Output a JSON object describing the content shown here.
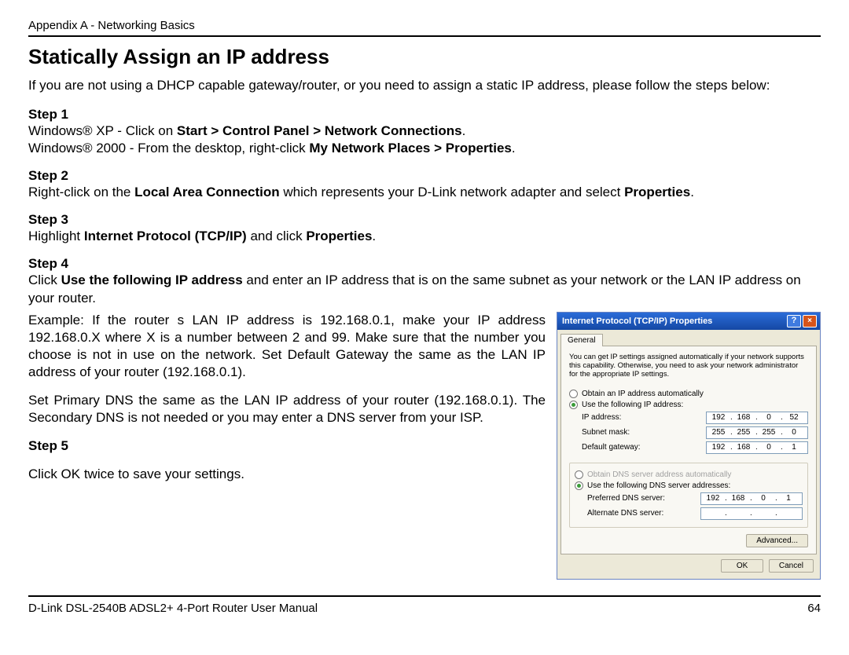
{
  "header": {
    "appendix": "Appendix A - Networking Basics"
  },
  "title": "Statically Assign an IP address",
  "intro": "If you are not using a DHCP capable gateway/router, or you need to assign a static IP address, please follow the steps below:",
  "steps": {
    "s1": {
      "label": "Step 1",
      "xp_prefix": "Windows® XP - Click on ",
      "xp_bold": "Start > Control Panel > Network Connections",
      "xp_suffix": ".",
      "w2k_prefix": "Windows® 2000 - From the desktop, right-click ",
      "w2k_bold": "My Network Places > Properties",
      "w2k_suffix": "."
    },
    "s2": {
      "label": "Step 2",
      "prefix": "Right-click on the ",
      "bold1": "Local Area Connection",
      "mid": " which represents your D-Link network adapter and select ",
      "bold2": "Properties",
      "suffix": "."
    },
    "s3": {
      "label": "Step 3",
      "prefix": "Highlight ",
      "bold1": "Internet Protocol (TCP/IP)",
      "mid": " and click ",
      "bold2": "Properties",
      "suffix": "."
    },
    "s4": {
      "label": "Step 4",
      "p1_prefix": "Click ",
      "p1_bold": "Use the following IP address",
      "p1_suffix": " and enter an IP address that is on the same subnet as your network or the LAN IP address on your router.",
      "p2": "Example: If the router s LAN IP address is 192.168.0.1, make your IP address 192.168.0.X where X is a number between 2 and 99. Make sure that the number you choose is not in use on the network. Set Default Gateway the same as the LAN IP address of your router (192.168.0.1).",
      "p3": "Set Primary DNS the same as the LAN IP address of your router (192.168.0.1). The Secondary DNS is not needed or you may enter a DNS server from your ISP."
    },
    "s5": {
      "label": "Step 5",
      "text": "Click OK twice to save your settings."
    }
  },
  "dialog": {
    "title": "Internet Protocol (TCP/IP) Properties",
    "tab": "General",
    "desc": "You can get IP settings assigned automatically if your network supports this capability. Otherwise, you need to ask your network administrator for the appropriate IP settings.",
    "radio_auto_ip": "Obtain an IP address automatically",
    "radio_use_ip": "Use the following IP address:",
    "lbl_ip": "IP address:",
    "lbl_subnet": "Subnet mask:",
    "lbl_gateway": "Default gateway:",
    "radio_auto_dns": "Obtain DNS server address automatically",
    "radio_use_dns": "Use the following DNS server addresses:",
    "lbl_pref_dns": "Preferred DNS server:",
    "lbl_alt_dns": "Alternate DNS server:",
    "btn_adv": "Advanced...",
    "btn_ok": "OK",
    "btn_cancel": "Cancel",
    "ip": {
      "a": "192",
      "b": "168",
      "c": "0",
      "d": "52"
    },
    "mask": {
      "a": "255",
      "b": "255",
      "c": "255",
      "d": "0"
    },
    "gw": {
      "a": "192",
      "b": "168",
      "c": "0",
      "d": "1"
    },
    "dns1": {
      "a": "192",
      "b": "168",
      "c": "0",
      "d": "1"
    },
    "dns2": {
      "a": "",
      "b": "",
      "c": "",
      "d": ""
    }
  },
  "footer": {
    "left": "D-Link DSL-2540B ADSL2+ 4-Port Router User Manual",
    "right": "64"
  }
}
